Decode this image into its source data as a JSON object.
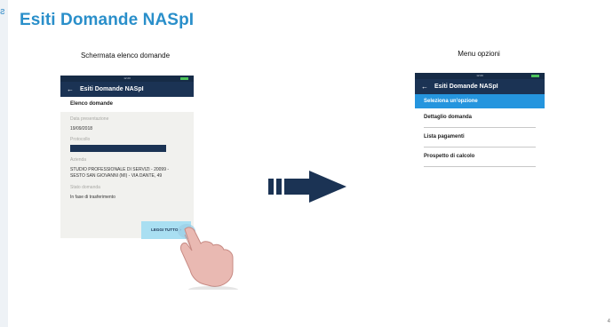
{
  "slide": {
    "title": "Esiti Domande NASpI",
    "caption_left": "Schermata elenco domande",
    "caption_right": "Menu opzioni",
    "page_number": "4",
    "logo_glyph": "ƨ"
  },
  "left_phone": {
    "status_time": "12:20",
    "appbar_back": "←",
    "appbar_title": "Esiti Domande NASpI",
    "section_title": "Elenco domande",
    "fields": {
      "data_label": "Data presentazione",
      "data_value": "19/09/2018",
      "protocollo_label": "Protocollo",
      "azienda_label": "Azienda",
      "azienda_value_line1": "STUDIO PROFESSIONALE DI SERVIZI - 20099 -",
      "azienda_value_line2": "SESTO SAN GIOVANNI (MI) - VIA DANTE, 49",
      "stato_label": "Stato domanda",
      "stato_value": "In fase di trasferimento"
    },
    "button_label": "LEGGI TUTTO",
    "button_chevron": "›"
  },
  "right_phone": {
    "status_time": "12:20",
    "appbar_back": "←",
    "appbar_title": "Esiti Domande NASpI",
    "selected_option": "Seleziona un'opzione",
    "options": [
      "Dettaglio domanda",
      "Lista pagamenti",
      "Prospetto di calcolo"
    ]
  },
  "colors": {
    "title_blue": "#2a8fca",
    "appbar_navy": "#1b3354",
    "selected_blue": "#2595de",
    "button_light_blue": "#a9dff2"
  },
  "icons": [
    "back-arrow-icon",
    "battery-icon",
    "right-arrow-icon",
    "pointing-hand-icon",
    "chevron-right-icon"
  ]
}
